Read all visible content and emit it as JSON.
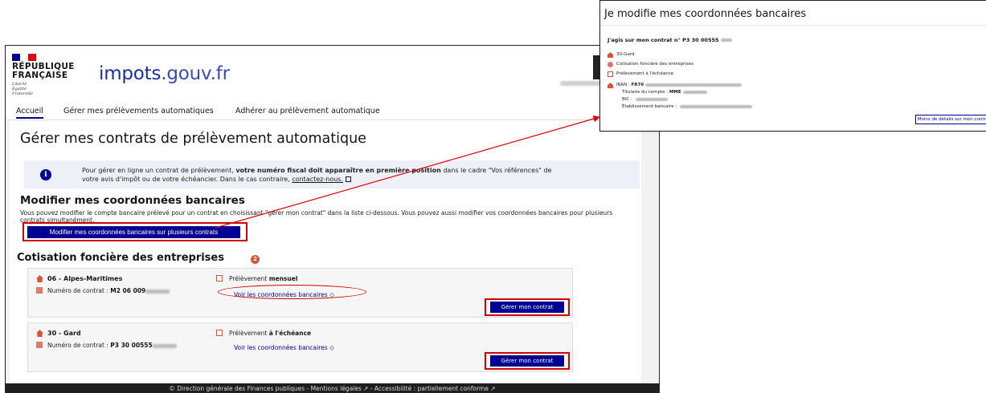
{
  "header": {
    "flag_colors": [
      "#000091",
      "#ffffff",
      "#e1000f"
    ],
    "republic": "RÉPUBLIQUE\nFRANÇAISE",
    "motto": "Liberté\nÉgalité\nFraternité",
    "site_a": "impots",
    "site_b": ".gouv.fr"
  },
  "nav": {
    "tabs": [
      "Accueil",
      "Gérer mes prélèvements automatiques",
      "Adhérer au prélèvement automatique"
    ]
  },
  "page": {
    "title": "Gérer mes contrats de prélèvement automatique",
    "notice_icon": "i",
    "notice_pre": "Pour gérer en ligne un contrat de prélèvement, ",
    "notice_bold": "votre numéro fiscal doit apparaître en première position",
    "notice_post": " dans le cadre \"Vos références\" de votre avis d'impôt ou de votre échéancier. Dans le cas contraire, ",
    "notice_link": "contactez-nous.",
    "external_icon": "external-link-icon"
  },
  "bank_section": {
    "title": "Modifier mes coordonnées bancaires",
    "text": "Vous pouvez modifier le compte bancaire prélevé pour un contrat en choisissant \"gérer mon contrat\" dans la liste ci-dessous. Vous pouvez aussi modifier vos coordonnées bancaires pour plusieurs contrats simultanément.",
    "button": "Modifier mes coordonnées bancaires sur plusieurs contrats"
  },
  "cfe": {
    "title": "Cotisation foncière des entreprises",
    "count": "2",
    "contracts": [
      {
        "dept": "06 - Alpes-Maritimes",
        "contract_label": "Numéro de contrat : ",
        "contract_no": "M2 06 009",
        "freq_label": "Prélèvement ",
        "freq": "mensuel",
        "link": "Voir les coordonnées bancaires",
        "button": "Gérer mon contrat"
      },
      {
        "dept": "30 - Gard",
        "contract_label": "Numéro de contrat : ",
        "contract_no": "P3 30 00555",
        "freq_label": "Prélèvement ",
        "freq": "à l'échéance",
        "link": "Voir les coordonnées bancaires",
        "button": "Gérer mon contrat"
      }
    ]
  },
  "footer": {
    "text": "© Direction générale des Finances publiques - Mentions légales ↗ - Accessibilité : partiellement conforme ↗"
  },
  "inset": {
    "title": "Je modifie mes coordonnées bancaires",
    "contract": "J'agis sur mon contrat n° P3 30 00555",
    "dept": "30-Gard",
    "tax": "Cotisation foncière des entreprises",
    "freq": "Prélèvement à l'échéance",
    "iban_label": "IBAN : ",
    "iban_value": "FR76",
    "holder_label": "Titulaire du compte : ",
    "holder_value": "MME",
    "bic_label": "BIC : ",
    "bank_label": "Établissement bancaire : ",
    "less_button": "Moins de détails sur mon contrat"
  },
  "colors": {
    "primary": "#000091",
    "highlight": "#ce0500",
    "accent": "#d6543e"
  }
}
